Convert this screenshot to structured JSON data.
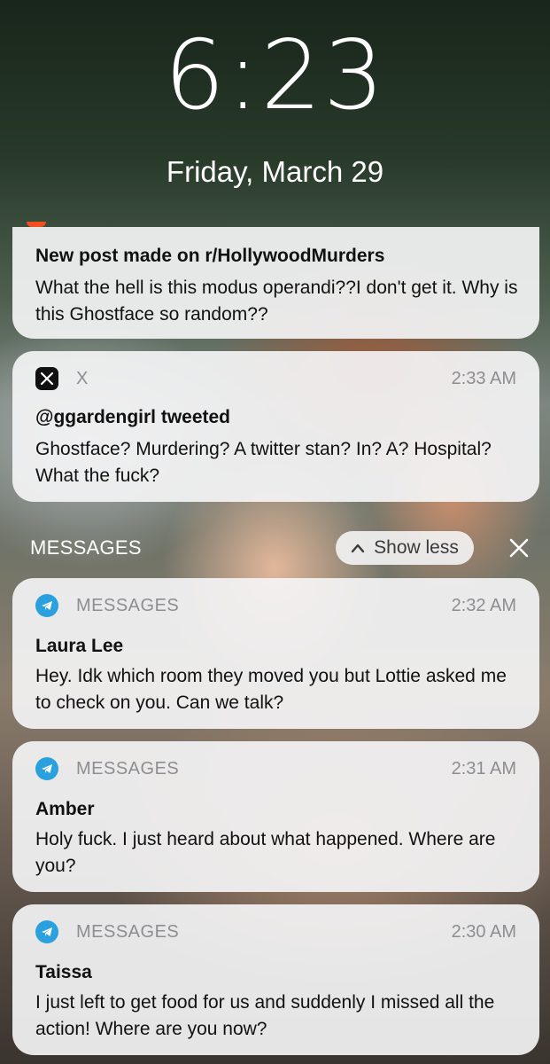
{
  "lockscreen": {
    "time": "6:23",
    "date": "Friday, March 29"
  },
  "notifications": {
    "reddit": {
      "title": "New post made on r/HollywoodMurders",
      "body": "What the hell is this modus operandi??I don't get it. Why is this Ghostface so random??"
    },
    "x": {
      "app": "X",
      "time": "2:33 AM",
      "title": "@ggardengirl tweeted",
      "body": "Ghostface? Murdering? A twitter stan? In? A? Hospital? What the fuck?"
    }
  },
  "group": {
    "label": "MESSAGES",
    "show_less_label": "Show less"
  },
  "messages": [
    {
      "app": "MESSAGES",
      "time": "2:32 AM",
      "sender": "Laura Lee",
      "body": "Hey. Idk which room they moved you but Lottie asked me to check on you. Can we talk?"
    },
    {
      "app": "MESSAGES",
      "time": "2:31 AM",
      "sender": "Amber",
      "body": "Holy fuck. I just heard about what happened. Where are you?"
    },
    {
      "app": "MESSAGES",
      "time": "2:30 AM",
      "sender": "Taissa",
      "body": "I just left to get food for us and suddenly I missed all the action! Where are you now?"
    }
  ],
  "icons": {
    "x_app": "x-logo-icon",
    "messages_app": "telegram-icon",
    "show_less": "chevron-up-icon",
    "close": "close-icon",
    "reddit_app": "reddit-icon"
  },
  "colors": {
    "card_bg": "#f4f4f5",
    "secondary_text": "#8d8d92",
    "telegram_blue": "#2aa1de",
    "reddit_orange": "#f24e1e"
  }
}
